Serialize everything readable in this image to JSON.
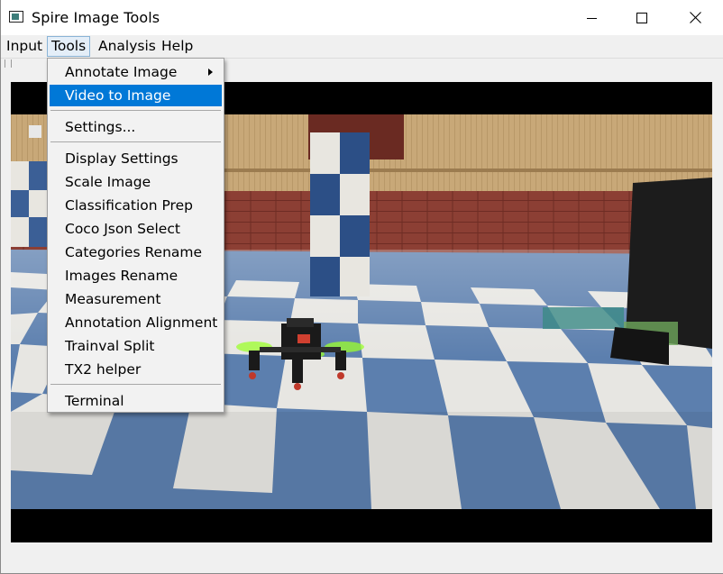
{
  "window": {
    "title": "Spire Image Tools"
  },
  "title_buttons": {
    "minimize_icon": "minimize-icon",
    "maximize_icon": "maximize-icon",
    "close_icon": "close-icon"
  },
  "menubar": {
    "items": [
      {
        "label": "Input"
      },
      {
        "label": "Tools",
        "active": true
      },
      {
        "label": "Analysis"
      },
      {
        "label": "Help"
      }
    ]
  },
  "tools_menu": {
    "items": [
      {
        "label": "Annotate Image",
        "submenu": true
      },
      {
        "label": "Video to Image",
        "highlighted": true
      },
      {
        "label": "Settings..."
      },
      {
        "label": "Display Settings"
      },
      {
        "label": "Scale Image"
      },
      {
        "label": "Classification Prep"
      },
      {
        "label": "Coco Json Select"
      },
      {
        "label": "Categories Rename"
      },
      {
        "label": "Images Rename"
      },
      {
        "label": "Measurement"
      },
      {
        "label": "Annotation Alignment"
      },
      {
        "label": "Trainval Split"
      },
      {
        "label": "TX2 helper"
      },
      {
        "label": "Terminal"
      }
    ]
  },
  "colors": {
    "highlight": "#0078d7",
    "menu_bg": "#f2f2f2",
    "window_bg": "#f0f0f0"
  }
}
